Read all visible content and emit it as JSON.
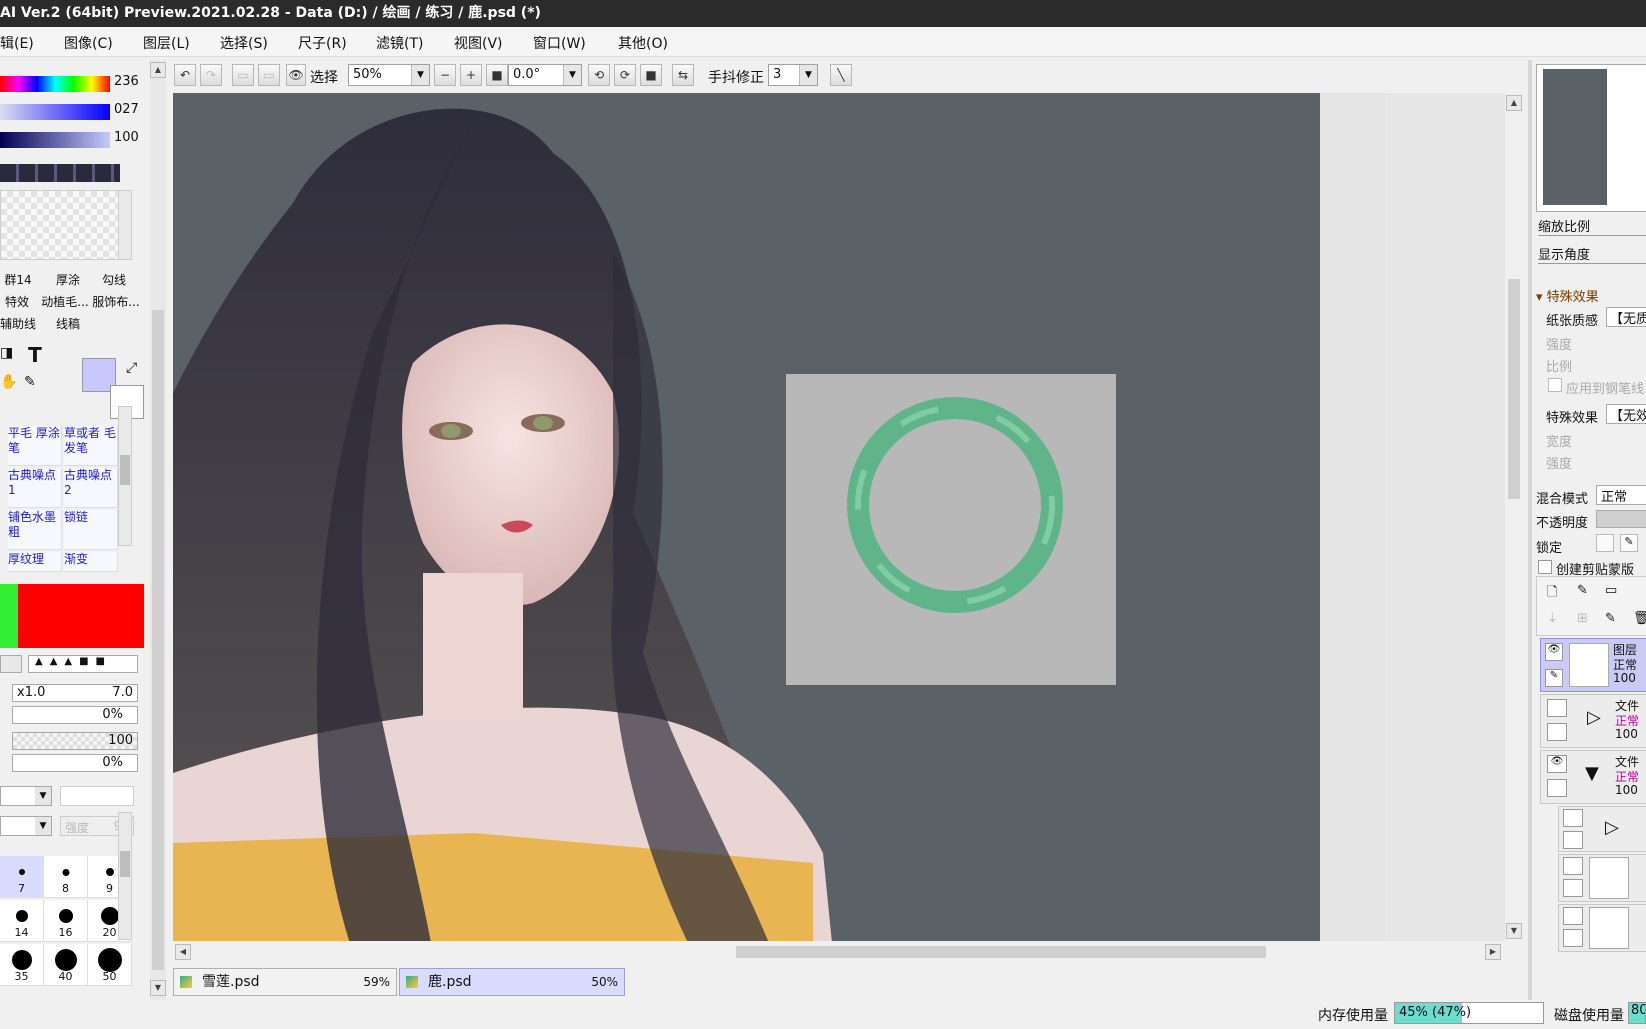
{
  "title": "AI Ver.2 (64bit) Preview.2021.02.28 - Data (D:) / 绘画 / 练习 / 鹿.psd (*)",
  "menu": [
    "辑(E)",
    "图像(C)",
    "图层(L)",
    "选择(S)",
    "尺子(R)",
    "滤镜(T)",
    "视图(V)",
    "窗口(W)",
    "其他(O)"
  ],
  "toolbar": {
    "select_label": "选择",
    "zoom": "50%",
    "angle": "0.0°",
    "stabilizer_label": "手抖修正",
    "stabilizer_value": "3"
  },
  "color_sliders": {
    "v1": "236",
    "v2": "027",
    "v3": "100"
  },
  "brush_sets": [
    "群14",
    "厚涂",
    "勾线",
    "特效",
    "动植毛...",
    "服饰布...",
    "辅助线",
    "线稿"
  ],
  "brushes": [
    {
      "name": "平毛 厚涂笔"
    },
    {
      "name": "草或者 毛发笔"
    },
    {
      "name": "古典噪点 1"
    },
    {
      "name": "古典噪点 2"
    },
    {
      "name": "铺色水墨 粗"
    },
    {
      "name": "锁链"
    },
    {
      "name": "厚纹理"
    },
    {
      "name": "渐变"
    }
  ],
  "brush_params": {
    "size_mult": "x1.0",
    "size": "7.0",
    "p1": "0%",
    "density": "100",
    "p2": "0%",
    "strength_label": "强度",
    "strength": "95"
  },
  "sizes": [
    {
      "label": "7",
      "d": 6
    },
    {
      "label": "8",
      "d": 7
    },
    {
      "label": "9",
      "d": 8
    },
    {
      "label": "14",
      "d": 12
    },
    {
      "label": "16",
      "d": 14
    },
    {
      "label": "20",
      "d": 18
    },
    {
      "label": "35",
      "d": 20
    },
    {
      "label": "40",
      "d": 22
    },
    {
      "label": "50",
      "d": 24
    }
  ],
  "doc_tabs": [
    {
      "name": "雪莲.psd",
      "zoom": "59%"
    },
    {
      "name": "鹿.psd",
      "zoom": "50%"
    }
  ],
  "right": {
    "zoom_label": "缩放比例",
    "angle_label": "显示角度",
    "fx_header": "特殊效果",
    "paper_label": "纸张质感",
    "paper_value": "【无质",
    "strength": "强度",
    "ratio": "比例",
    "apply_pen": "应用到钢笔线",
    "fx_label": "特殊效果",
    "fx_value": "【无效",
    "width": "宽度",
    "strength2": "强度",
    "blend_label": "混合模式",
    "blend_value": "正常",
    "opacity_label": "不透明度",
    "lock_label": "锁定",
    "clip_label": "创建剪贴蒙版",
    "layers": [
      {
        "name": "图层",
        "mode": "正常",
        "opacity": "100"
      },
      {
        "name": "文件",
        "mode": "正常",
        "opacity": "100"
      },
      {
        "name": "文件",
        "mode": "正常",
        "opacity": "100"
      }
    ]
  },
  "status": {
    "mem_label": "内存使用量",
    "mem_value": "45% (47%)",
    "mem_fraction": 0.45,
    "disk_label": "磁盘使用量",
    "disk_value": "80"
  }
}
